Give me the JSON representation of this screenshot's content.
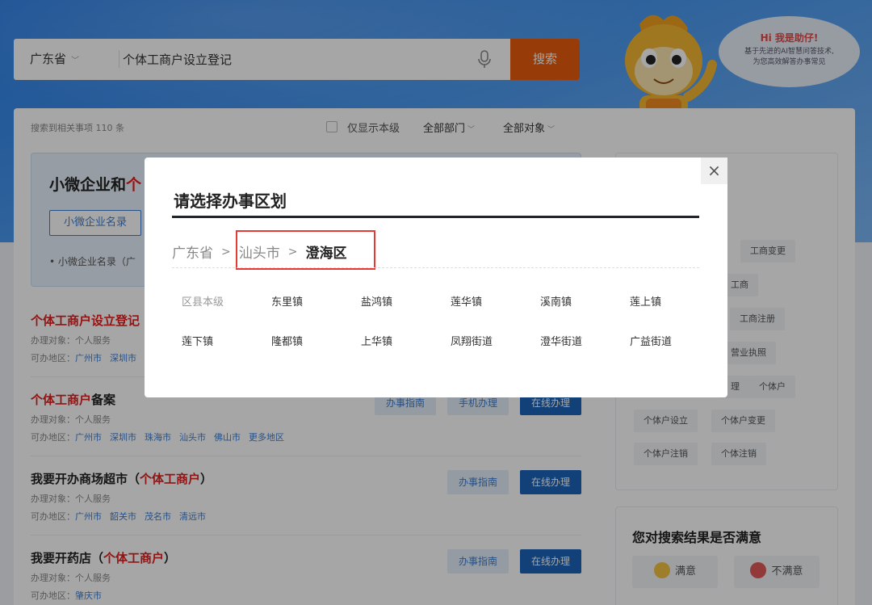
{
  "search": {
    "province": "广东省",
    "query": "个体工商户设立登记",
    "button": "搜索"
  },
  "assistant": {
    "greeting": "Hi 我是助仔!",
    "desc_line1": "基于先进的AI智慧问答技术,",
    "desc_line2": "为您高效解答办事常见"
  },
  "results_meta": {
    "count_text": "搜索到相关事项 110 条",
    "only_this_level": "仅显示本级",
    "dept_filter": "全部部门",
    "target_filter": "全部对象"
  },
  "hot_card": {
    "title_black": "小微企业和",
    "title_red": "个",
    "tab": "小微企业名录",
    "bullet": "小微企业名录（广"
  },
  "results": [
    {
      "title_red": "个体工商户设立登记",
      "title_black": "",
      "object": "办理对象：个人服务",
      "area_label": "可办地区：",
      "areas": [
        "广州市",
        "深圳市"
      ],
      "guide": "",
      "mobile": "",
      "online": ""
    },
    {
      "title_red": "个体工商户",
      "title_black": "备案",
      "object": "办理对象：个人服务",
      "area_label": "可办地区：",
      "areas": [
        "广州市",
        "深圳市",
        "珠海市",
        "汕头市",
        "佛山市",
        "更多地区"
      ],
      "guide": "办事指南",
      "mobile": "手机办理",
      "online": "在线办理"
    },
    {
      "title_pre": "我要开办商场超市（",
      "title_red": "个体工商户",
      "title_post": "）",
      "object": "办理对象：个人服务",
      "area_label": "可办地区：",
      "areas": [
        "广州市",
        "韶关市",
        "茂名市",
        "清远市"
      ],
      "guide": "办事指南",
      "online": "在线办理"
    },
    {
      "title_pre": "我要开药店（",
      "title_red": "个体工商户",
      "title_post": "）",
      "object": "办理对象：个人服务",
      "area_label": "可办地区：",
      "areas": [
        "肇庆市"
      ],
      "guide": "办事指南",
      "online": "在线办理"
    }
  ],
  "side_tags": [
    "工商变更",
    "工商",
    "工商注册",
    "营业执照",
    "理",
    "个体户",
    "个体户设立",
    "个体户变更",
    "个体户注销",
    "个体注销"
  ],
  "satisfaction": {
    "title": "您对搜索结果是否满意",
    "yes": "满意",
    "no": "不满意"
  },
  "modal": {
    "title": "请选择办事区划",
    "breadcrumb": [
      "广东省",
      "汕头市",
      "澄海区"
    ],
    "close": "×",
    "towns": [
      "区县本级",
      "东里镇",
      "盐鸿镇",
      "莲华镇",
      "溪南镇",
      "莲上镇",
      "莲下镇",
      "隆都镇",
      "上华镇",
      "凤翔街道",
      "澄华街道",
      "广益街道"
    ]
  },
  "colors": {
    "search_button": "#e85c0e",
    "primary_blue": "#1d63b8",
    "highlight_red": "#e53935",
    "keyword_red": "#e02020"
  }
}
